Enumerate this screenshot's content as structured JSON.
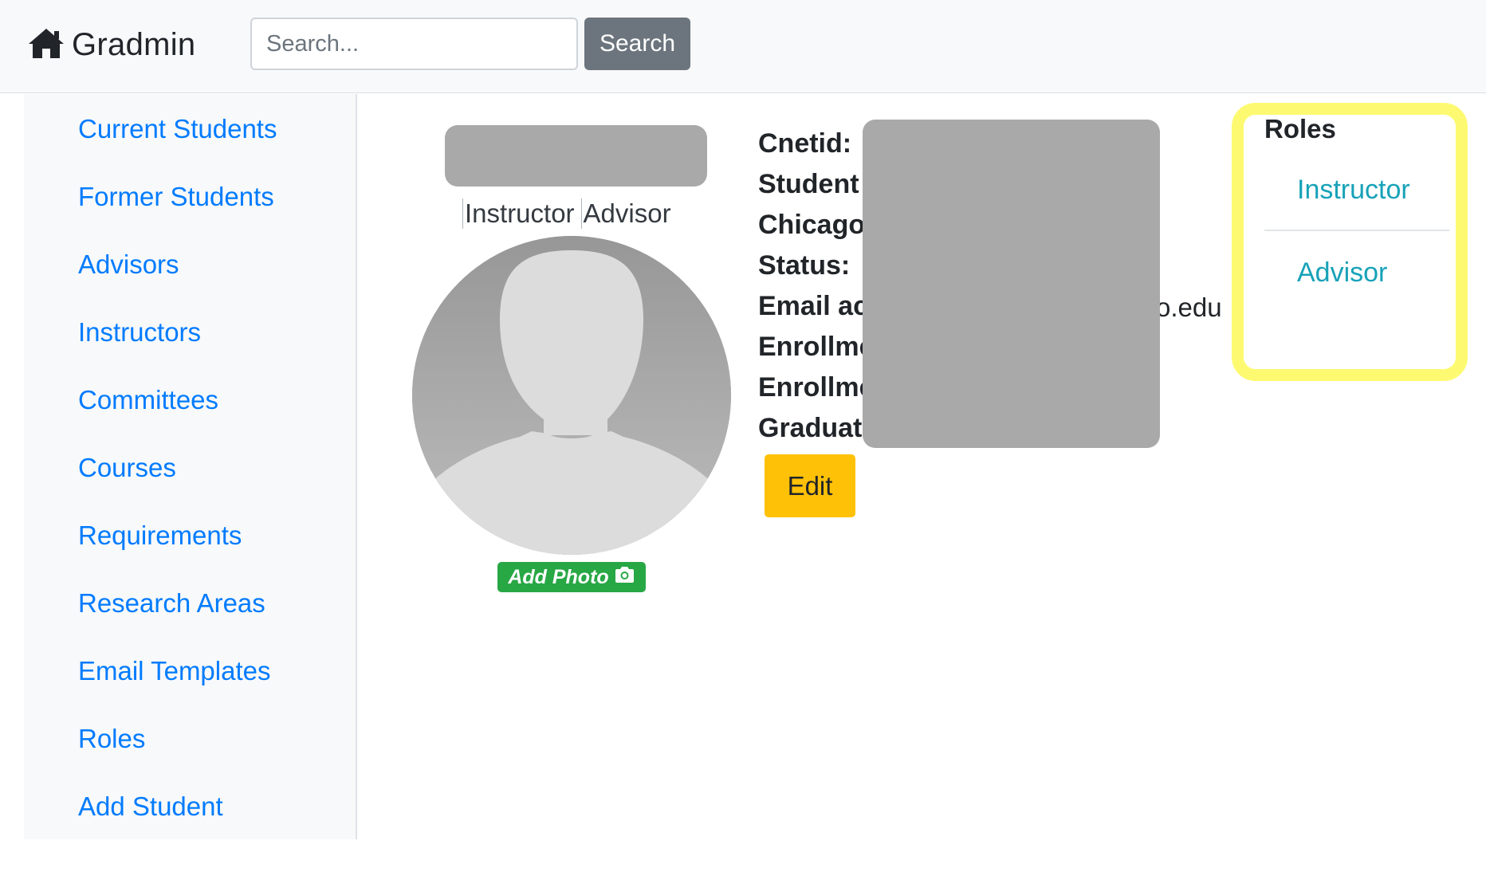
{
  "navbar": {
    "brand": "Gradmin",
    "brand_icon": "home-icon",
    "search": {
      "placeholder": "Search...",
      "value": "",
      "button_label": "Search"
    }
  },
  "sidebar": {
    "items": [
      {
        "label": "Current Students"
      },
      {
        "label": "Former Students"
      },
      {
        "label": "Advisors"
      },
      {
        "label": "Instructors"
      },
      {
        "label": "Committees"
      },
      {
        "label": "Courses"
      },
      {
        "label": "Requirements"
      },
      {
        "label": "Research Areas"
      },
      {
        "label": "Email Templates"
      },
      {
        "label": "Roles"
      },
      {
        "label": "Add Student"
      }
    ]
  },
  "profile": {
    "name_redacted": true,
    "role_tags": [
      "Instructor",
      "Advisor"
    ],
    "avatar_icon": "user-silhouette-icon",
    "add_photo_label": "Add Photo",
    "add_photo_icon": "camera-icon"
  },
  "details": {
    "fields": [
      {
        "label": "Cnetid:"
      },
      {
        "label": "Student"
      },
      {
        "label": "Chicago"
      },
      {
        "label": "Status:"
      },
      {
        "label": "Email ac"
      },
      {
        "label": "Enrollme"
      },
      {
        "label": "Enrollme"
      },
      {
        "label": "Graduat"
      }
    ],
    "email_visible_tail": "o.edu",
    "values_redacted": true,
    "edit_label": "Edit"
  },
  "roles_panel": {
    "title": "Roles",
    "items": [
      "Instructor",
      "Advisor"
    ],
    "highlight_color": "#fdfa72"
  },
  "colors": {
    "link": "#007bff",
    "role_link": "#17a2b8",
    "edit_button": "#ffc107",
    "add_photo_button": "#28a745",
    "search_button": "#6c757d",
    "redaction": "#a9a9a9"
  }
}
